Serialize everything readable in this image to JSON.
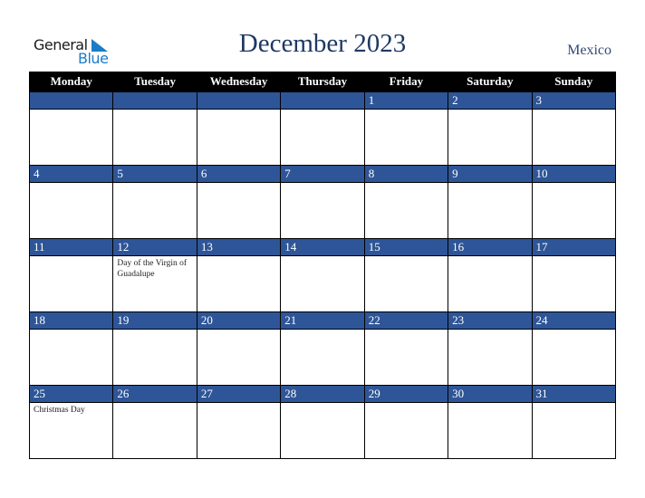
{
  "logo": {
    "word1": "General",
    "word2": "Blue"
  },
  "title": "December 2023",
  "country": "Mexico",
  "colors": {
    "header_bg": "#000000",
    "day_bar": "#2e5597",
    "title": "#1f3864",
    "logo_blue": "#1c7cc7"
  },
  "weekdays": [
    "Monday",
    "Tuesday",
    "Wednesday",
    "Thursday",
    "Friday",
    "Saturday",
    "Sunday"
  ],
  "weeks": [
    [
      {
        "d": ""
      },
      {
        "d": ""
      },
      {
        "d": ""
      },
      {
        "d": ""
      },
      {
        "d": "1"
      },
      {
        "d": "2"
      },
      {
        "d": "3"
      }
    ],
    [
      {
        "d": "4"
      },
      {
        "d": "5"
      },
      {
        "d": "6"
      },
      {
        "d": "7"
      },
      {
        "d": "8"
      },
      {
        "d": "9"
      },
      {
        "d": "10"
      }
    ],
    [
      {
        "d": "11"
      },
      {
        "d": "12",
        "e": "Day of the Virgin of Guadalupe"
      },
      {
        "d": "13"
      },
      {
        "d": "14"
      },
      {
        "d": "15"
      },
      {
        "d": "16"
      },
      {
        "d": "17"
      }
    ],
    [
      {
        "d": "18"
      },
      {
        "d": "19"
      },
      {
        "d": "20"
      },
      {
        "d": "21"
      },
      {
        "d": "22"
      },
      {
        "d": "23"
      },
      {
        "d": "24"
      }
    ],
    [
      {
        "d": "25",
        "e": "Christmas Day"
      },
      {
        "d": "26"
      },
      {
        "d": "27"
      },
      {
        "d": "28"
      },
      {
        "d": "29"
      },
      {
        "d": "30"
      },
      {
        "d": "31"
      }
    ]
  ]
}
